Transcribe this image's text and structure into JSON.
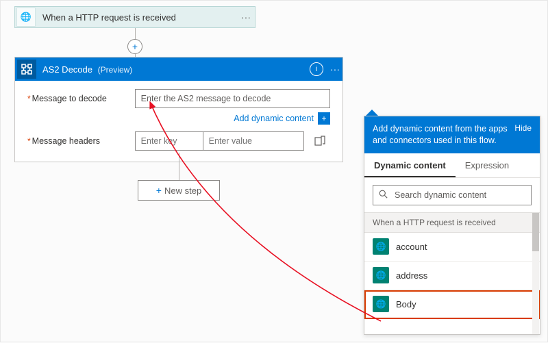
{
  "trigger": {
    "title": "When a HTTP request is received",
    "icon": "globe-icon"
  },
  "action": {
    "name": "AS2 Decode",
    "badge": "(Preview)",
    "fields": {
      "message_label": "Message to decode",
      "message_placeholder": "Enter the AS2 message to decode",
      "headers_label": "Message headers",
      "key_placeholder": "Enter key",
      "value_placeholder": "Enter value"
    },
    "dynamic_link": "Add dynamic content"
  },
  "newstep": {
    "label": "New step",
    "plus": "+"
  },
  "panel": {
    "header": "Add dynamic content from the apps and connectors used in this flow.",
    "hide": "Hide",
    "tabs": {
      "dynamic": "Dynamic content",
      "expression": "Expression"
    },
    "search_placeholder": "Search dynamic content",
    "group_title": "When a HTTP request is received",
    "items": [
      {
        "label": "account"
      },
      {
        "label": "address"
      },
      {
        "label": "Body"
      }
    ]
  }
}
